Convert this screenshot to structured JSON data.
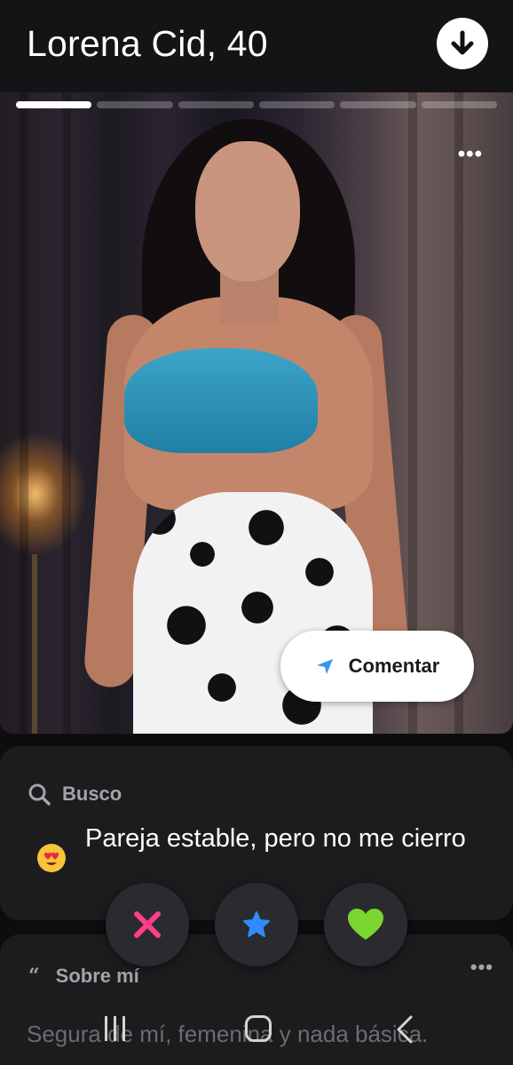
{
  "header": {
    "title": "Lorena Cid, 40"
  },
  "photo": {
    "total_photos": 6,
    "active_index": 1
  },
  "actions": {
    "comment_label": "Comentar"
  },
  "busco": {
    "label": "Busco",
    "text": "Pareja estable, pero no me cierro"
  },
  "sobre": {
    "label": "Sobre mí",
    "text": "Segura de mí, femenina y nada básica."
  },
  "colors": {
    "accent_pink": "#ff3d8b",
    "accent_blue": "#2f8cff",
    "accent_green": "#7cd630",
    "card_bg": "#1c1c1f"
  }
}
